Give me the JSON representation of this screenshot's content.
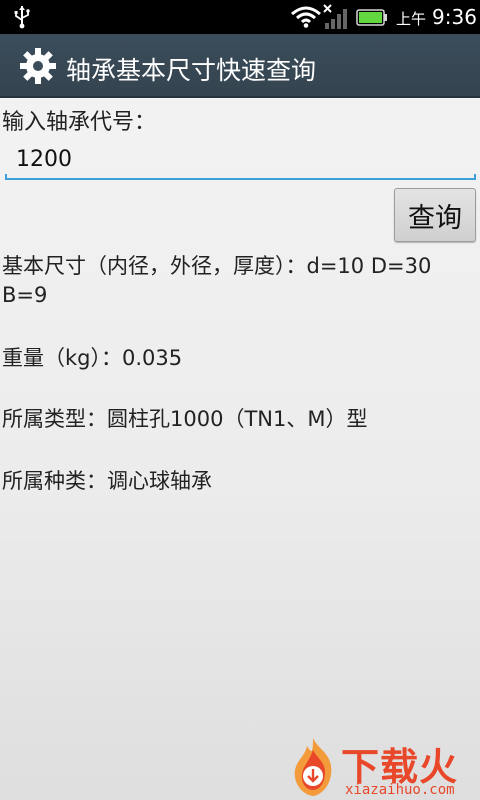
{
  "status_bar": {
    "am_pm": "上午",
    "time": "9:36",
    "icons": [
      "usb-icon",
      "wifi-icon",
      "signal-icon",
      "battery-icon"
    ]
  },
  "app": {
    "title": "轴承基本尺寸快速查询",
    "icon": "gear-icon",
    "title_bar_color": "#3b4c5b"
  },
  "form": {
    "label": "输入轴承代号：",
    "value": "1200",
    "query_button": "查询",
    "accent_color": "#3f9fd9"
  },
  "results": {
    "basic_size": "基本尺寸（内径，外径，厚度）：d=10 D=30  B=9",
    "weight": "重量（kg）：0.035",
    "type": "所属类型：圆柱孔1000（TN1、M）型",
    "category": "所属种类：调心球轴承"
  },
  "watermark": {
    "brand": "下载火",
    "domain": "xiazaihuo.com",
    "color": "#e8472a"
  }
}
